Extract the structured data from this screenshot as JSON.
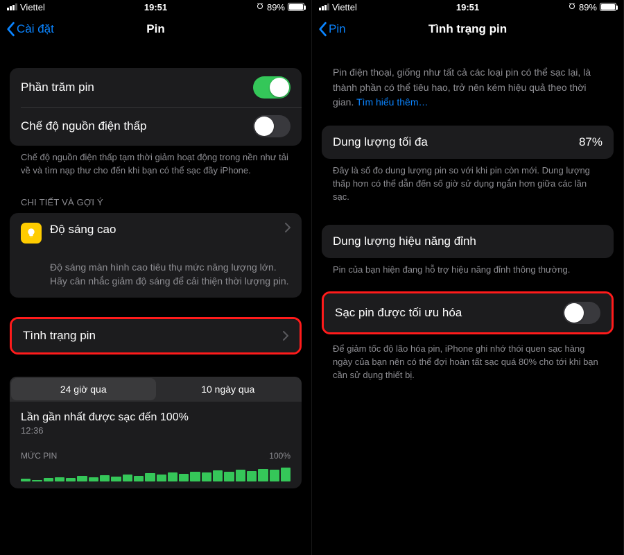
{
  "status": {
    "carrier": "Viettel",
    "time": "19:51",
    "battery_pct": "89%",
    "battery_fill_pct": 89
  },
  "left": {
    "back_label": "Cài đặt",
    "title": "Pin",
    "battery_percent_label": "Phần trăm pin",
    "low_power_label": "Chế độ nguồn điện thấp",
    "low_power_footer": "Chế độ nguồn điện thấp tạm thời giảm hoạt động trong nền như tải về và tìm nạp thư cho đến khi bạn có thể sạc đầy iPhone.",
    "insights_header": "CHI TIẾT VÀ GỢI Ý",
    "brightness_title": "Độ sáng cao",
    "brightness_desc": "Độ sáng màn hình cao tiêu thụ mức năng lượng lớn. Hãy cân nhắc giảm độ sáng để cải thiện thời lượng pin.",
    "battery_health_label": "Tình trạng pin",
    "seg_24h": "24 giờ qua",
    "seg_10d": "10 ngày qua",
    "last_charged_label": "Lần gần nhất được sạc đến 100%",
    "last_charged_time": "12:36",
    "battery_level_header": "MỨC PIN",
    "hundred": "100%"
  },
  "right": {
    "back_label": "Pin",
    "title": "Tình trạng pin",
    "intro_text": "Pin điện thoại, giống như tất cả các loại pin có thể sạc lại, là thành phần có thể tiêu hao, trở nên kém hiệu quả theo thời gian. ",
    "intro_link": "Tìm hiểu thêm…",
    "max_capacity_label": "Dung lượng tối đa",
    "max_capacity_value": "87%",
    "max_capacity_footer": "Đây là số đo dung lượng pin so với khi pin còn mới. Dung lượng thấp hơn có thể dẫn đến số giờ sử dụng ngắn hơn giữa các lần sạc.",
    "peak_perf_label": "Dung lượng hiệu năng đỉnh",
    "peak_perf_footer": "Pin của bạn hiện đang hỗ trợ hiệu năng đỉnh thông thường.",
    "optimized_label": "Sạc pin được tối ưu hóa",
    "optimized_footer": "Để giảm tốc độ lão hóa pin, iPhone ghi nhớ thói quen sạc hàng ngày của bạn nên có thể đợi hoàn tất sạc quá 80% cho tới khi bạn cần sử dụng thiết bị."
  },
  "chart_data": {
    "type": "bar",
    "title": "MỨC PIN",
    "ylim": [
      0,
      100
    ],
    "values": [
      18,
      10,
      22,
      26,
      20,
      30,
      24,
      34,
      28,
      40,
      32,
      46,
      38,
      52,
      44,
      56,
      50,
      62,
      54,
      68,
      60,
      72,
      66,
      78
    ],
    "note": "approximate battery-level bars as rendered (partial, cut off at bottom of screenshot)"
  }
}
